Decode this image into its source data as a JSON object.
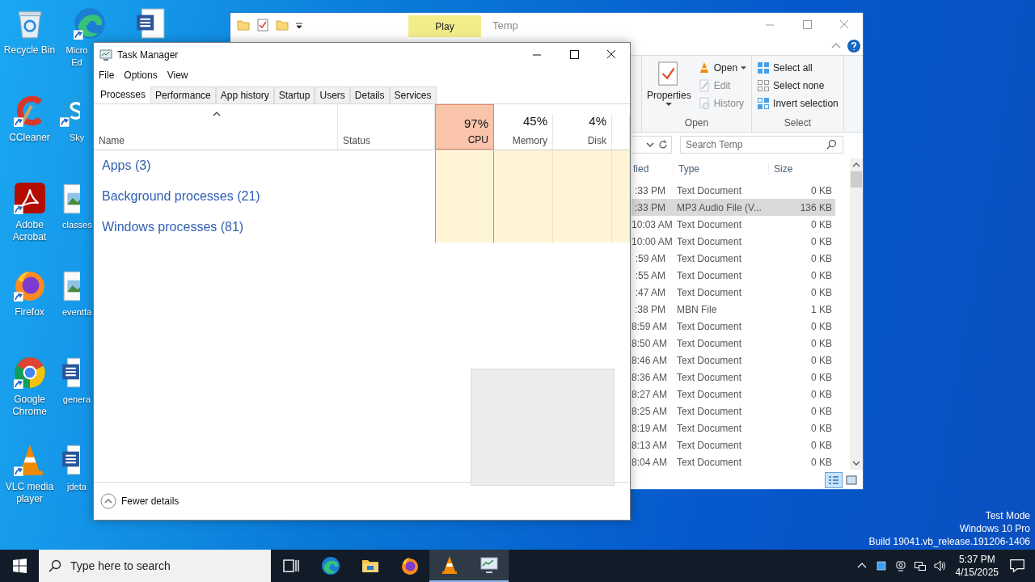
{
  "desktop": {
    "icons": [
      {
        "label": "Recycle Bin",
        "kind": "recycle-bin",
        "shortcut": false
      },
      {
        "label": "CCleaner",
        "kind": "ccleaner",
        "shortcut": true
      },
      {
        "label": "Adobe Acrobat",
        "kind": "acrobat",
        "shortcut": true
      },
      {
        "label": "Firefox",
        "kind": "firefox",
        "shortcut": true
      },
      {
        "label": "Google Chrome",
        "kind": "chrome",
        "shortcut": true
      },
      {
        "label": "VLC media player",
        "kind": "vlc",
        "shortcut": true
      },
      {
        "label": "Micro Ed",
        "kind": "edge",
        "shortcut": true
      },
      {
        "label": "Sky",
        "kind": "skype",
        "shortcut": true
      },
      {
        "label": "classes",
        "kind": "image",
        "shortcut": false
      },
      {
        "label": "eventfa",
        "kind": "image",
        "shortcut": false
      },
      {
        "label": "genera",
        "kind": "word",
        "shortcut": false
      },
      {
        "label": "jdeta",
        "kind": "word",
        "shortcut": false
      },
      {
        "kind": "word",
        "shortcut": false
      }
    ],
    "info": [
      "Test Mode",
      "Windows 10 Pro",
      "Build 19041.vb_release.191206-1406"
    ]
  },
  "explorer": {
    "contextual_tab": "Play",
    "title": "Temp",
    "ribbon": [
      {
        "label": "Open",
        "large": "Properties",
        "items": [
          {
            "label": "Open",
            "kind": "open",
            "dropdown": true,
            "disabled": false
          },
          {
            "label": "Edit",
            "kind": "edit",
            "dropdown": false,
            "disabled": true
          },
          {
            "label": "History",
            "kind": "history",
            "dropdown": false,
            "disabled": true
          }
        ]
      },
      {
        "label": "Select",
        "items": [
          {
            "label": "Select all",
            "kind": "select-all",
            "dropdown": false,
            "disabled": false
          },
          {
            "label": "Select none",
            "kind": "select-none",
            "dropdown": false,
            "disabled": false
          },
          {
            "label": "Invert selection",
            "kind": "invert",
            "dropdown": false,
            "disabled": false
          }
        ]
      }
    ],
    "search": {
      "placeholder": "Search Temp"
    },
    "columns": [
      "fied",
      "Type",
      "Size"
    ],
    "files": [
      {
        "modified": ":33 PM",
        "type": "Text Document",
        "size": "0 KB",
        "selected": false
      },
      {
        "modified": ":33 PM",
        "type": "MP3 Audio File (V...",
        "size": "136 KB",
        "selected": true
      },
      {
        "modified": "10:03 AM",
        "type": "Text Document",
        "size": "0 KB",
        "selected": false
      },
      {
        "modified": "10:00 AM",
        "type": "Text Document",
        "size": "0 KB",
        "selected": false
      },
      {
        "modified": ":59 AM",
        "type": "Text Document",
        "size": "0 KB",
        "selected": false
      },
      {
        "modified": ":55 AM",
        "type": "Text Document",
        "size": "0 KB",
        "selected": false
      },
      {
        "modified": ":47 AM",
        "type": "Text Document",
        "size": "0 KB",
        "selected": false
      },
      {
        "modified": ":38 PM",
        "type": "MBN File",
        "size": "1 KB",
        "selected": false
      },
      {
        "modified": "8:59 AM",
        "type": "Text Document",
        "size": "0 KB",
        "selected": false
      },
      {
        "modified": "8:50 AM",
        "type": "Text Document",
        "size": "0 KB",
        "selected": false
      },
      {
        "modified": "8:46 AM",
        "type": "Text Document",
        "size": "0 KB",
        "selected": false
      },
      {
        "modified": "8:36 AM",
        "type": "Text Document",
        "size": "0 KB",
        "selected": false
      },
      {
        "modified": "8:27 AM",
        "type": "Text Document",
        "size": "0 KB",
        "selected": false
      },
      {
        "modified": "8:25 AM",
        "type": "Text Document",
        "size": "0 KB",
        "selected": false
      },
      {
        "modified": "8:19 AM",
        "type": "Text Document",
        "size": "0 KB",
        "selected": false
      },
      {
        "modified": "8:13 AM",
        "type": "Text Document",
        "size": "0 KB",
        "selected": false
      },
      {
        "modified": "8:04 AM",
        "type": "Text Document",
        "size": "0 KB",
        "selected": false
      }
    ]
  },
  "task_manager": {
    "title": "Task Manager",
    "menu": [
      "File",
      "Options",
      "View"
    ],
    "tabs": [
      {
        "label": "Processes",
        "selected": true
      },
      {
        "label": "Performance",
        "selected": false
      },
      {
        "label": "App history",
        "selected": false
      },
      {
        "label": "Startup",
        "selected": false
      },
      {
        "label": "Users",
        "selected": false
      },
      {
        "label": "Details",
        "selected": false
      },
      {
        "label": "Services",
        "selected": false
      }
    ],
    "columns": [
      {
        "label": "Name",
        "kind": "name"
      },
      {
        "label": "Status",
        "kind": "status"
      },
      {
        "label": "CPU",
        "reading": "97%",
        "kind": "metric",
        "alert": true
      },
      {
        "label": "Memory",
        "reading": "45%",
        "kind": "metric",
        "alert": false
      },
      {
        "label": "Disk",
        "reading": "4%",
        "kind": "metric",
        "alert": false
      }
    ],
    "groups": [
      "Apps (3)",
      "Background processes (21)",
      "Windows processes (81)"
    ],
    "footer": "Fewer details"
  },
  "taskbar": {
    "search": {
      "placeholder": "Type here to search"
    },
    "apps": [
      {
        "kind": "task-view",
        "active": false
      },
      {
        "kind": "edge",
        "active": false
      },
      {
        "kind": "explorer",
        "active": false
      },
      {
        "kind": "firefox",
        "active": false
      },
      {
        "kind": "vlc",
        "active": true
      },
      {
        "kind": "task-manager",
        "active": true
      }
    ],
    "time": "5:37 PM",
    "date": "4/15/2025"
  }
}
